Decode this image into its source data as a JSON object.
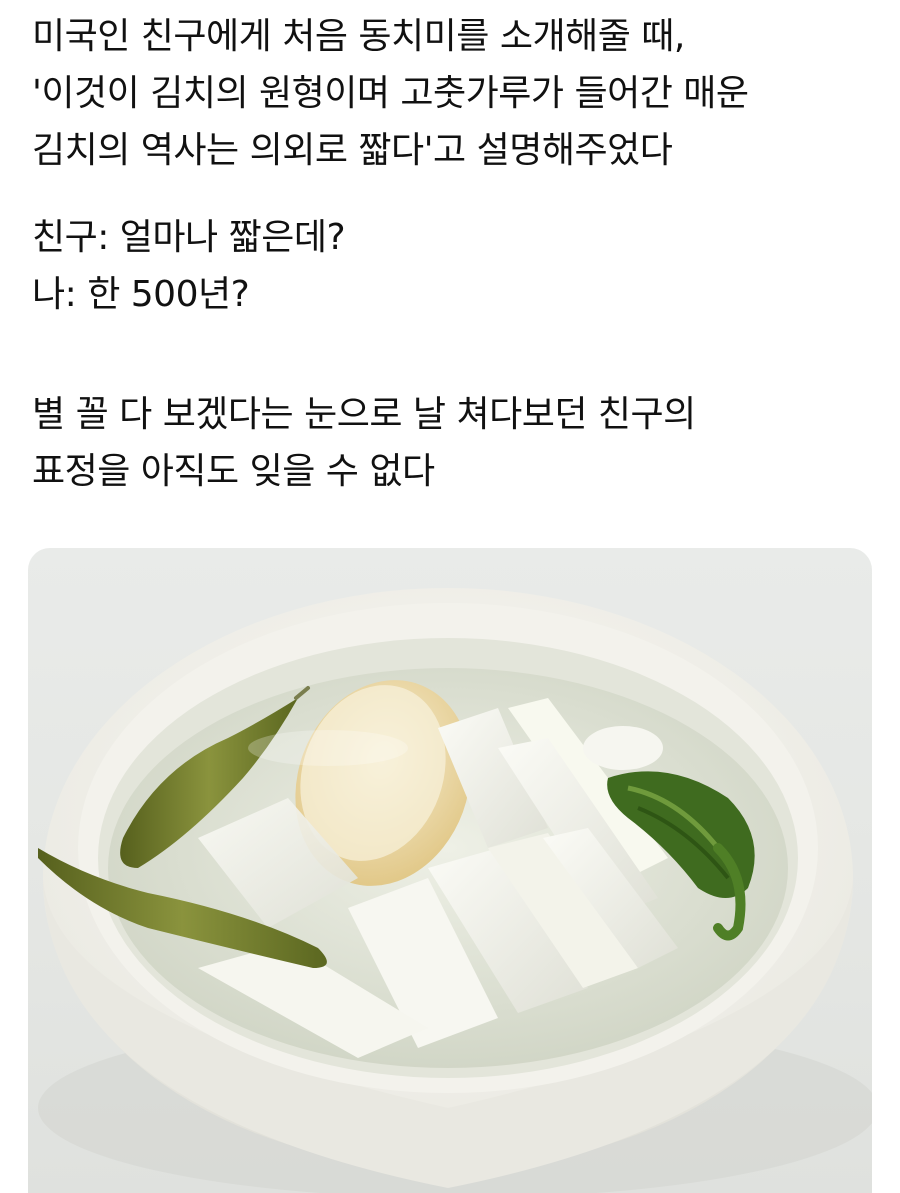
{
  "post": {
    "paragraph_1": [
      "미국인 친구에게 처음 동치미를 소개해줄 때,",
      "'이것이 김치의 원형이며 고춧가루가 들어간 매운",
      "김치의 역사는 의외로 짧다'고 설명해주었다"
    ],
    "paragraph_2": [
      "친구: 얼마나 짧은데?",
      "나: 한 500년?"
    ],
    "paragraph_3": [
      "별 꼴 다 보겠다는 눈으로 날 쳐다보던 친구의",
      "표정을 아직도 잊을 수 없다"
    ]
  },
  "photo": {
    "subject": "dongchimi-bowl",
    "colors": {
      "bowl": "#f4f2ec",
      "broth": "#dfe3d8",
      "radish": "#f6f5ee",
      "radish_round": "#f3e7c3",
      "pepper": "#6d7a2e",
      "greens": "#3f6b1f"
    }
  }
}
